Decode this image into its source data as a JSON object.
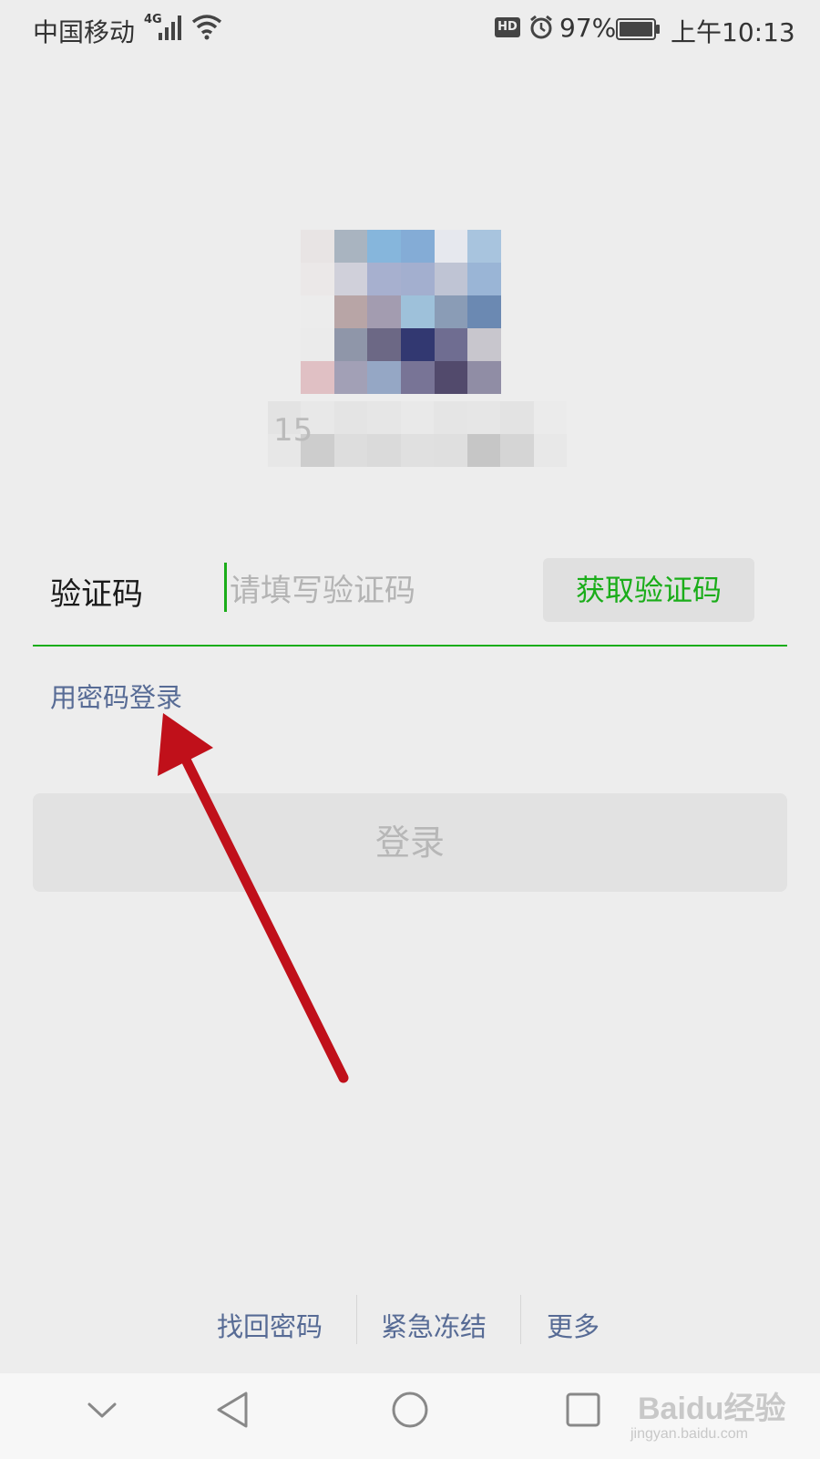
{
  "status_bar": {
    "carrier": "中国移动",
    "network": "4G",
    "battery_percent": "97%",
    "time": "上午10:13",
    "icons": [
      "signal-icon",
      "wifi-icon",
      "hd-icon",
      "alarm-icon",
      "battery-icon"
    ]
  },
  "profile": {
    "avatar": "pixelated-avatar",
    "account_hint": "15"
  },
  "verification": {
    "label": "验证码",
    "placeholder": "请填写验证码",
    "value": "",
    "get_code_label": "获取验证码"
  },
  "password_login_link": "用密码登录",
  "login_button": "登录",
  "bottom_links": [
    "找回密码",
    "紧急冻结",
    "更多"
  ],
  "nav": {
    "icons": [
      "chevron-down-icon",
      "back-triangle-icon",
      "home-circle-icon",
      "recents-square-icon"
    ]
  },
  "watermark": {
    "brand": "Baidu经验",
    "sub": "jingyan.baidu.com"
  },
  "colors": {
    "background": "#ededed",
    "accent_green": "#1aad19",
    "link_blue": "#576b95",
    "annotation_red": "#c0101a"
  }
}
